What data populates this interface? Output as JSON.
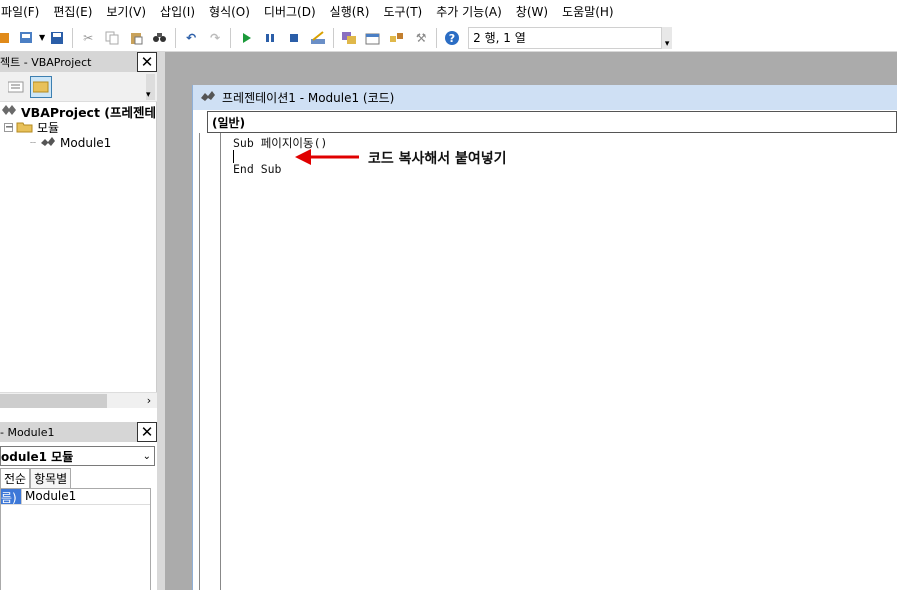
{
  "menubar": {
    "items": [
      "파일(F)",
      "편집(E)",
      "보기(V)",
      "삽입(I)",
      "형식(O)",
      "디버그(D)",
      "실행(R)",
      "도구(T)",
      "추가 기능(A)",
      "창(W)",
      "도움말(H)"
    ]
  },
  "toolbar": {
    "position": "2 행, 1 열"
  },
  "project_panel": {
    "title": "젝트 - VBAProject",
    "tree": {
      "root": "VBAProject (프레젠테",
      "folder": "모듈",
      "module": "Module1"
    }
  },
  "properties_panel": {
    "title": "- Module1",
    "object_select": "odule1 모듈",
    "tabs": [
      "전순",
      "항목별"
    ],
    "row": {
      "key": "름)",
      "value": "Module1"
    }
  },
  "code_window": {
    "title": "프레젠테이션1 - Module1 (코드)",
    "object_combo": "(일반)",
    "code_lines": [
      "Sub 페이지이동()",
      "",
      "End Sub"
    ],
    "annotation": "코드 복사해서 붙여넣기",
    "annotation_color": "#e00000"
  }
}
